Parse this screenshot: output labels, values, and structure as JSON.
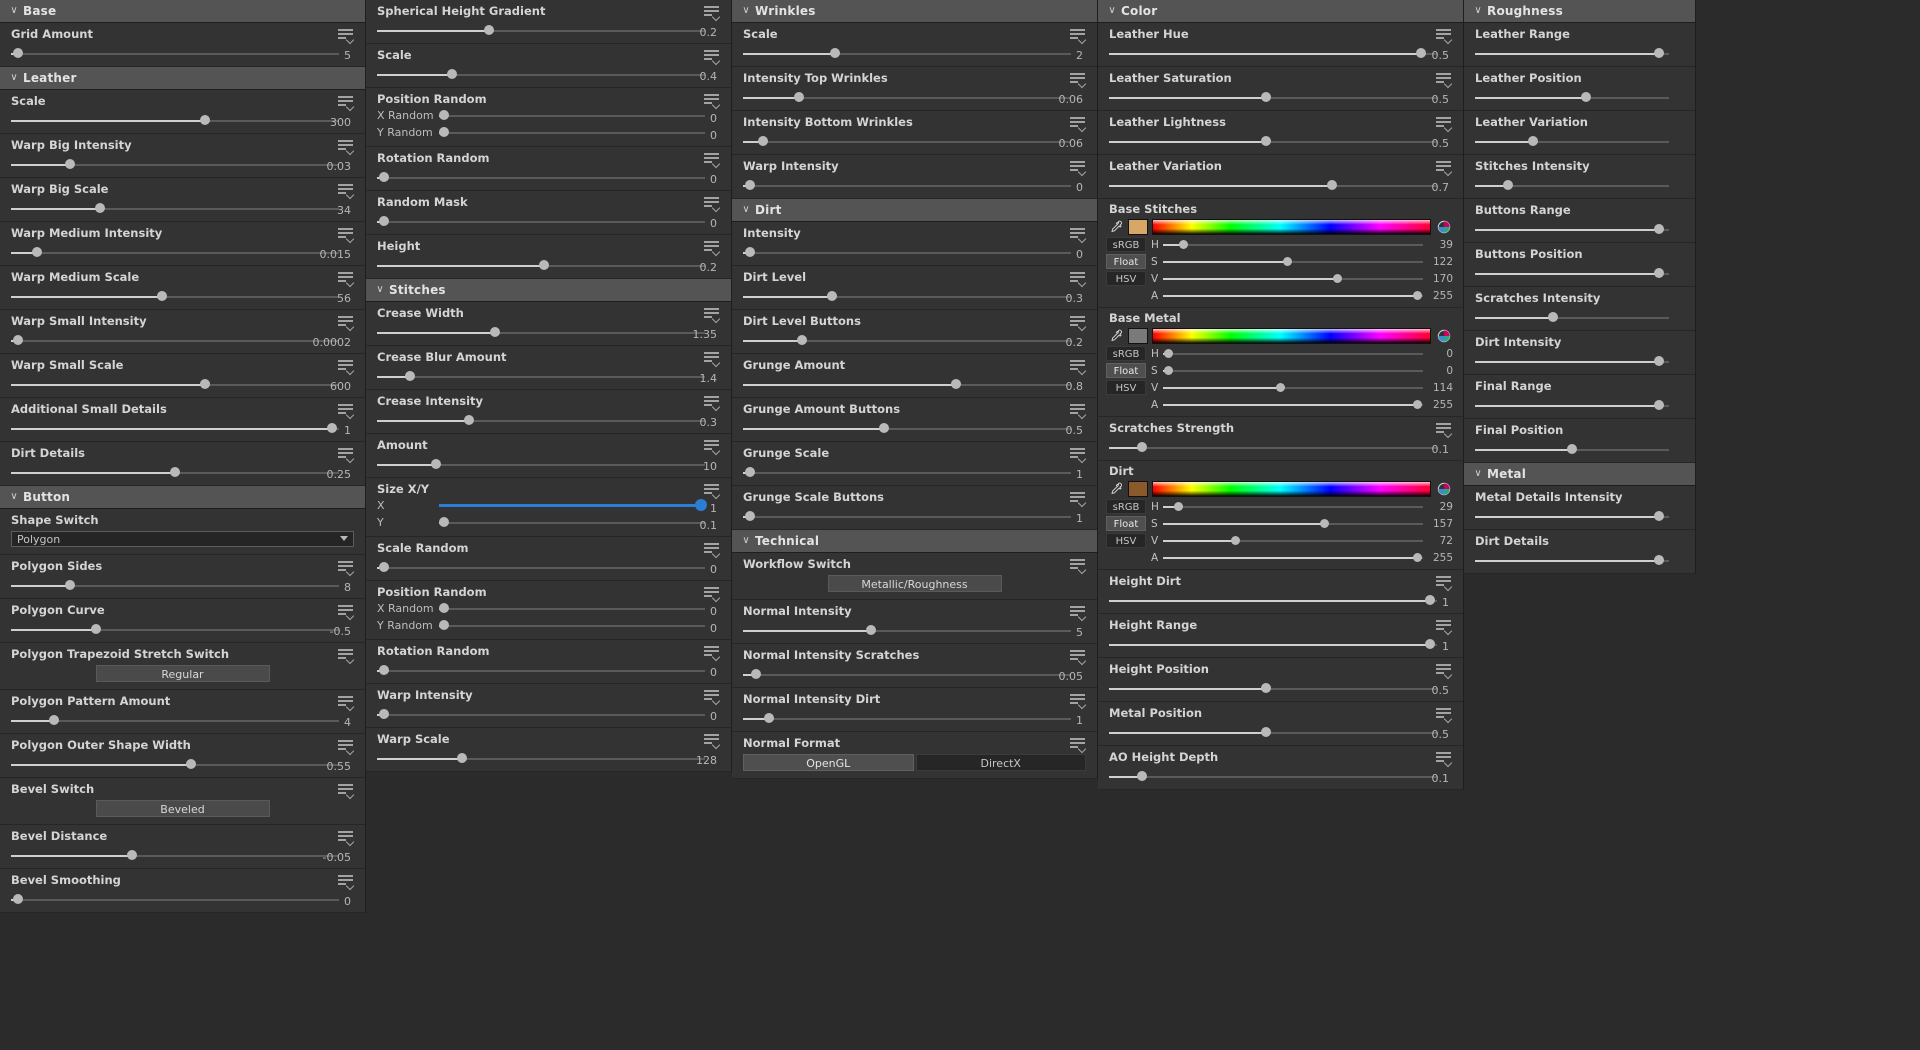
{
  "colors": {
    "panel_bg": "#2b2b2b",
    "row_bg": "#333333",
    "group_header_bg": "#545454",
    "accent_blue": "#2a7fd4",
    "swatch_base_stitches": "#d6a767",
    "swatch_base_metal": "#7a7a7a",
    "swatch_dirt": "#8a5a2a"
  },
  "icons": {
    "chevron": "⌄",
    "hamburger": "parameter-menu-icon",
    "eyedropper": "eyedropper-icon",
    "colorwheel": "color-wheel-icon"
  },
  "columns": [
    {
      "name": "column-1",
      "groups": [
        {
          "title": "Base",
          "params": [
            {
              "label": "Grid Amount",
              "value": "5",
              "pos": 2,
              "menu": true,
              "type": "slider"
            }
          ]
        },
        {
          "title": "Leather",
          "params": [
            {
              "label": "Scale",
              "value": "300",
              "pos": 59,
              "menu": true,
              "type": "slider"
            },
            {
              "label": "Warp Big Intensity",
              "value": "0.03",
              "pos": 18,
              "menu": true,
              "type": "slider"
            },
            {
              "label": "Warp Big Scale",
              "value": "34",
              "pos": 27,
              "menu": true,
              "type": "slider"
            },
            {
              "label": "Warp Medium Intensity",
              "value": "0.015",
              "pos": 8,
              "menu": true,
              "type": "slider"
            },
            {
              "label": "Warp Medium Scale",
              "value": "56",
              "pos": 46,
              "menu": true,
              "type": "slider"
            },
            {
              "label": "Warp Small Intensity",
              "value": "0.0002",
              "pos": 2,
              "menu": true,
              "type": "slider"
            },
            {
              "label": "Warp Small Scale",
              "value": "600",
              "pos": 59,
              "menu": true,
              "type": "slider"
            },
            {
              "label": "Additional Small Details",
              "value": "1",
              "pos": 98,
              "menu": true,
              "type": "slider"
            },
            {
              "label": "Dirt Details",
              "value": "0.25",
              "pos": 50,
              "menu": true,
              "type": "slider"
            }
          ]
        },
        {
          "title": "Button",
          "params": [
            {
              "label": "Shape Switch",
              "value": "Polygon",
              "menu": false,
              "type": "dropdown"
            },
            {
              "label": "Polygon Sides",
              "value": "8",
              "pos": 18,
              "menu": true,
              "type": "slider"
            },
            {
              "label": "Polygon Curve",
              "value": "-0.5",
              "pos": 26,
              "menu": true,
              "type": "slider"
            },
            {
              "label": "Polygon Trapezoid Stretch Switch",
              "value": "Regular",
              "menu": true,
              "type": "button"
            },
            {
              "label": "Polygon Pattern Amount",
              "value": "4",
              "pos": 13,
              "menu": true,
              "type": "slider"
            },
            {
              "label": "Polygon Outer Shape Width",
              "value": "0.55",
              "pos": 55,
              "menu": true,
              "type": "slider"
            },
            {
              "label": "Bevel Switch",
              "value": "Beveled",
              "menu": true,
              "type": "button"
            },
            {
              "label": "Bevel Distance",
              "value": "-0.05",
              "pos": 37,
              "menu": true,
              "type": "slider"
            },
            {
              "label": "Bevel Smoothing",
              "value": "0",
              "pos": 2,
              "menu": true,
              "type": "slider"
            }
          ]
        }
      ]
    },
    {
      "name": "column-2",
      "groups": [
        {
          "title": null,
          "params": [
            {
              "label": "Spherical Height Gradient",
              "value": "0.2",
              "pos": 34,
              "menu": true,
              "type": "slider"
            },
            {
              "label": "Scale",
              "value": "0.4",
              "pos": 23,
              "menu": true,
              "type": "slider"
            },
            {
              "label": "Position Random",
              "menu": true,
              "type": "dualsub",
              "subs": [
                {
                  "label": "X Random",
                  "value": "0",
                  "pos": 2
                },
                {
                  "label": "Y Random",
                  "value": "0",
                  "pos": 2
                }
              ]
            },
            {
              "label": "Rotation Random",
              "value": "0",
              "pos": 2,
              "menu": true,
              "type": "slider"
            },
            {
              "label": "Random Mask",
              "value": "0",
              "pos": 2,
              "menu": true,
              "type": "slider"
            },
            {
              "label": "Height",
              "value": "0.2",
              "pos": 51,
              "menu": true,
              "type": "slider"
            }
          ]
        },
        {
          "title": "Stitches",
          "params": [
            {
              "label": "Crease Width",
              "value": "1.35",
              "pos": 36,
              "menu": true,
              "type": "slider"
            },
            {
              "label": "Crease Blur Amount",
              "value": "1.4",
              "pos": 10,
              "menu": true,
              "type": "slider"
            },
            {
              "label": "Crease Intensity",
              "value": "0.3",
              "pos": 28,
              "menu": true,
              "type": "slider"
            },
            {
              "label": "Amount",
              "value": "10",
              "pos": 18,
              "menu": true,
              "type": "slider"
            },
            {
              "label": "Size X/Y",
              "menu": true,
              "type": "dualsub",
              "highlight": true,
              "subs": [
                {
                  "label": "X",
                  "value": "1",
                  "pos": 98,
                  "highlight": true
                },
                {
                  "label": "Y",
                  "value": "0.1",
                  "pos": 2
                }
              ]
            },
            {
              "label": "Scale Random",
              "value": "0",
              "pos": 2,
              "menu": true,
              "type": "slider"
            },
            {
              "label": "Position Random",
              "menu": true,
              "type": "dualsub",
              "subs": [
                {
                  "label": "X Random",
                  "value": "0",
                  "pos": 2
                },
                {
                  "label": "Y Random",
                  "value": "0",
                  "pos": 2
                }
              ]
            },
            {
              "label": "Rotation Random",
              "value": "0",
              "pos": 2,
              "menu": true,
              "type": "slider"
            },
            {
              "label": "Warp Intensity",
              "value": "0",
              "pos": 2,
              "menu": true,
              "type": "slider"
            },
            {
              "label": "Warp Scale",
              "value": "128",
              "pos": 26,
              "menu": true,
              "type": "slider"
            }
          ]
        }
      ]
    },
    {
      "name": "column-3",
      "groups": [
        {
          "title": "Wrinkles",
          "params": [
            {
              "label": "Scale",
              "value": "2",
              "pos": 28,
              "menu": true,
              "type": "slider"
            },
            {
              "label": "Intensity Top Wrinkles",
              "value": "0.06",
              "pos": 17,
              "menu": true,
              "type": "slider"
            },
            {
              "label": "Intensity Bottom Wrinkles",
              "value": "0.06",
              "pos": 6,
              "menu": true,
              "type": "slider"
            },
            {
              "label": "Warp Intensity",
              "value": "0",
              "pos": 2,
              "menu": true,
              "type": "slider"
            }
          ]
        },
        {
          "title": "Dirt",
          "params": [
            {
              "label": "Intensity",
              "value": "0",
              "pos": 2,
              "menu": true,
              "type": "slider"
            },
            {
              "label": "Dirt Level",
              "value": "0.3",
              "pos": 27,
              "menu": true,
              "type": "slider"
            },
            {
              "label": "Dirt Level Buttons",
              "value": "0.2",
              "pos": 18,
              "menu": true,
              "type": "slider"
            },
            {
              "label": "Grunge Amount",
              "value": "0.8",
              "pos": 65,
              "menu": true,
              "type": "slider"
            },
            {
              "label": "Grunge Amount Buttons",
              "value": "0.5",
              "pos": 43,
              "menu": true,
              "type": "slider"
            },
            {
              "label": "Grunge Scale",
              "value": "1",
              "pos": 2,
              "menu": true,
              "type": "slider"
            },
            {
              "label": "Grunge Scale Buttons",
              "value": "1",
              "pos": 2,
              "menu": true,
              "type": "slider"
            }
          ]
        },
        {
          "title": "Technical",
          "params": [
            {
              "label": "Workflow Switch",
              "value": "Metallic/Roughness",
              "menu": true,
              "type": "button"
            },
            {
              "label": "Normal Intensity",
              "value": "5",
              "pos": 39,
              "menu": true,
              "type": "slider"
            },
            {
              "label": "Normal Intensity Scratches",
              "value": "0.05",
              "pos": 4,
              "menu": true,
              "type": "slider"
            },
            {
              "label": "Normal Intensity Dirt",
              "value": "1",
              "pos": 8,
              "menu": true,
              "type": "slider"
            },
            {
              "label": "Normal Format",
              "menu": true,
              "type": "segmented",
              "options": [
                "OpenGL",
                "DirectX"
              ],
              "selected": "OpenGL"
            }
          ]
        }
      ]
    },
    {
      "name": "column-4",
      "groups": [
        {
          "title": "Color",
          "params": [
            {
              "label": "Leather Hue",
              "value": "0.5",
              "pos": 95,
              "menu": true,
              "type": "slider"
            },
            {
              "label": "Leather Saturation",
              "value": "0.5",
              "pos": 48,
              "menu": true,
              "type": "slider"
            },
            {
              "label": "Leather Lightness",
              "value": "0.5",
              "pos": 48,
              "menu": true,
              "type": "slider"
            },
            {
              "label": "Leather Variation",
              "value": "0.7",
              "pos": 68,
              "menu": true,
              "type": "slider"
            }
          ]
        },
        {
          "title": null,
          "colorwidgets": [
            {
              "title": "Base Stitches",
              "swatch": "#d6a767",
              "modes": [
                "sRGB",
                "Float",
                "HSV"
              ],
              "selected_mode": "Float",
              "channels": [
                {
                  "name": "H",
                  "value": "39",
                  "pos": 8
                },
                {
                  "name": "S",
                  "value": "122",
                  "pos": 48
                },
                {
                  "name": "V",
                  "value": "170",
                  "pos": 67
                },
                {
                  "name": "A",
                  "value": "255",
                  "pos": 98
                }
              ]
            },
            {
              "title": "Base Metal",
              "swatch": "#7a7a7a",
              "modes": [
                "sRGB",
                "Float",
                "HSV"
              ],
              "selected_mode": "Float",
              "channels": [
                {
                  "name": "H",
                  "value": "0",
                  "pos": 2
                },
                {
                  "name": "S",
                  "value": "0",
                  "pos": 2
                },
                {
                  "name": "V",
                  "value": "114",
                  "pos": 45
                },
                {
                  "name": "A",
                  "value": "255",
                  "pos": 98
                }
              ]
            }
          ]
        },
        {
          "title": null,
          "params": [
            {
              "label": "Scratches Strength",
              "value": "0.1",
              "pos": 10,
              "menu": true,
              "type": "slider"
            }
          ]
        },
        {
          "title": null,
          "colorwidgets": [
            {
              "title": "Dirt",
              "swatch": "#8a5a2a",
              "modes": [
                "sRGB",
                "Float",
                "HSV"
              ],
              "selected_mode": "Float",
              "channels": [
                {
                  "name": "H",
                  "value": "29",
                  "pos": 6
                },
                {
                  "name": "S",
                  "value": "157",
                  "pos": 62
                },
                {
                  "name": "V",
                  "value": "72",
                  "pos": 28
                },
                {
                  "name": "A",
                  "value": "255",
                  "pos": 98
                }
              ]
            }
          ]
        },
        {
          "title": null,
          "params": [
            {
              "label": "Height Dirt",
              "value": "1",
              "pos": 98,
              "menu": true,
              "type": "slider"
            },
            {
              "label": "Height Range",
              "value": "1",
              "pos": 98,
              "menu": true,
              "type": "slider"
            },
            {
              "label": "Height Position",
              "value": "0.5",
              "pos": 48,
              "menu": true,
              "type": "slider"
            },
            {
              "label": "Metal Position",
              "value": "0.5",
              "pos": 48,
              "menu": true,
              "type": "slider"
            },
            {
              "label": "AO Height Depth",
              "value": "0.1",
              "pos": 10,
              "menu": true,
              "type": "slider"
            }
          ]
        }
      ]
    },
    {
      "name": "column-5",
      "groups": [
        {
          "title": "Roughness",
          "params": [
            {
              "label": "Leather Range",
              "value": "",
              "pos": 95,
              "menu": false,
              "type": "slider"
            },
            {
              "label": "Leather Position",
              "value": "",
              "pos": 57,
              "menu": false,
              "type": "slider"
            },
            {
              "label": "Leather Variation",
              "value": "",
              "pos": 30,
              "menu": false,
              "type": "slider"
            },
            {
              "label": "Stitches Intensity",
              "value": "",
              "pos": 17,
              "menu": false,
              "type": "slider"
            },
            {
              "label": "Buttons Range",
              "value": "",
              "pos": 95,
              "menu": false,
              "type": "slider"
            },
            {
              "label": "Buttons Position",
              "value": "",
              "pos": 95,
              "menu": false,
              "type": "slider"
            },
            {
              "label": "Scratches Intensity",
              "value": "",
              "pos": 40,
              "menu": false,
              "type": "slider"
            },
            {
              "label": "Dirt Intensity",
              "value": "",
              "pos": 95,
              "menu": false,
              "type": "slider"
            },
            {
              "label": "Final Range",
              "value": "",
              "pos": 95,
              "menu": false,
              "type": "slider"
            },
            {
              "label": "Final Position",
              "value": "",
              "pos": 50,
              "menu": false,
              "type": "slider"
            }
          ]
        },
        {
          "title": "Metal",
          "params": [
            {
              "label": "Metal Details Intensity",
              "value": "",
              "pos": 95,
              "menu": false,
              "type": "slider"
            },
            {
              "label": "Dirt Details",
              "value": "",
              "pos": 95,
              "menu": false,
              "type": "slider"
            }
          ]
        }
      ]
    }
  ]
}
